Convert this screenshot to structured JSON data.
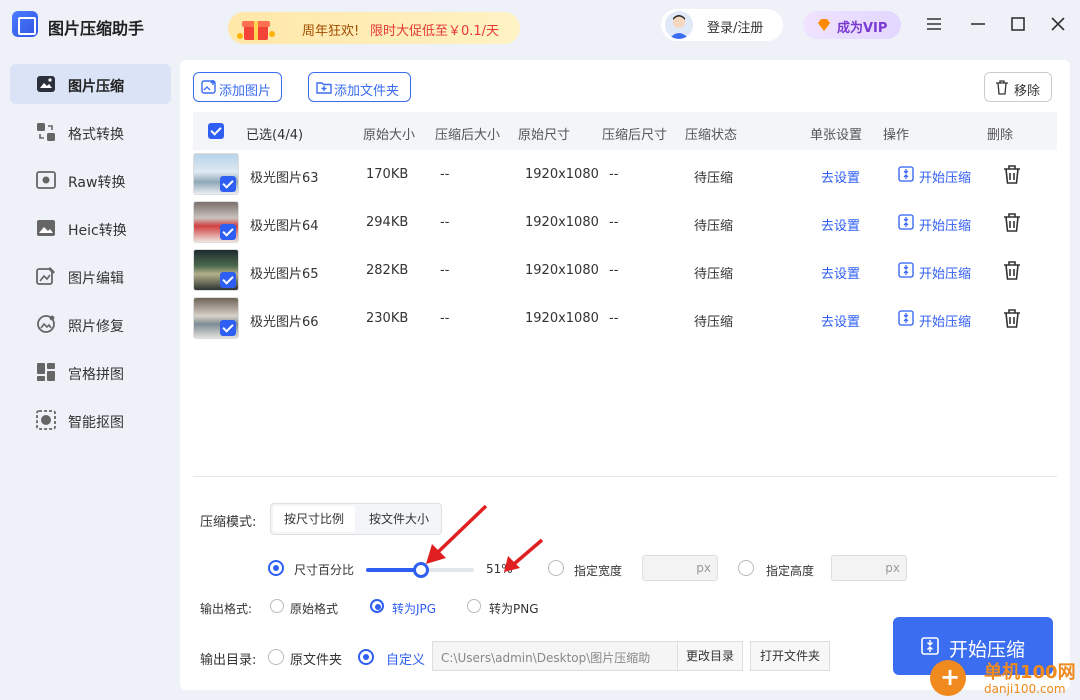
{
  "app": {
    "title": "图片压缩助手"
  },
  "promo": {
    "text1": "周年狂欢!",
    "text2": "限时大促低至￥0.1/天"
  },
  "user": {
    "login_label": "登录/注册"
  },
  "vip": {
    "label": "成为VIP"
  },
  "sidebar": {
    "items": [
      {
        "label": "图片压缩",
        "icon": "image-compress-icon",
        "active": true
      },
      {
        "label": "格式转换",
        "icon": "format-convert-icon"
      },
      {
        "label": "Raw转换",
        "icon": "raw-convert-icon"
      },
      {
        "label": "Heic转换",
        "icon": "heic-convert-icon"
      },
      {
        "label": "图片编辑",
        "icon": "image-edit-icon"
      },
      {
        "label": "照片修复",
        "icon": "photo-repair-icon"
      },
      {
        "label": "宫格拼图",
        "icon": "grid-collage-icon"
      },
      {
        "label": "智能抠图",
        "icon": "smart-cutout-icon"
      }
    ]
  },
  "toolbar": {
    "add_image": "添加图片",
    "add_folder": "添加文件夹",
    "remove": "移除"
  },
  "table": {
    "headers": {
      "selected": "已选(4/4)",
      "original_size": "原始大小",
      "compressed_size": "压缩后大小",
      "original_dim": "原始尺寸",
      "compressed_dim": "压缩后尺寸",
      "status": "压缩状态",
      "single_setting": "单张设置",
      "action": "操作",
      "delete": "删除"
    },
    "rows": [
      {
        "name": "极光图片63",
        "original_size": "170KB",
        "compressed_size": "--",
        "original_dim": "1920x1080",
        "compressed_dim": "--",
        "status": "待压缩",
        "setting": "去设置",
        "action": "开始压缩"
      },
      {
        "name": "极光图片64",
        "original_size": "294KB",
        "compressed_size": "--",
        "original_dim": "1920x1080",
        "compressed_dim": "--",
        "status": "待压缩",
        "setting": "去设置",
        "action": "开始压缩"
      },
      {
        "name": "极光图片65",
        "original_size": "282KB",
        "compressed_size": "--",
        "original_dim": "1920x1080",
        "compressed_dim": "--",
        "status": "待压缩",
        "setting": "去设置",
        "action": "开始压缩"
      },
      {
        "name": "极光图片66",
        "original_size": "230KB",
        "compressed_size": "--",
        "original_dim": "1920x1080",
        "compressed_dim": "--",
        "status": "待压缩",
        "setting": "去设置",
        "action": "开始压缩"
      }
    ]
  },
  "settings": {
    "mode_label": "压缩模式:",
    "mode_tabs": [
      "按尺寸比例",
      "按文件大小"
    ],
    "percent_label": "尺寸百分比",
    "percent_value": "51%",
    "percent_level": 0.51,
    "width_label": "指定宽度",
    "height_label": "指定高度",
    "px_unit": "px",
    "format_label": "输出格式:",
    "format_options": [
      "原始格式",
      "转为JPG",
      "转为PNG"
    ],
    "dir_label": "输出目录:",
    "dir_options": [
      "原文件夹",
      "自定义"
    ],
    "dir_path": "C:\\Users\\admin\\Desktop\\图片压缩助",
    "change_dir": "更改目录",
    "open_folder": "打开文件夹"
  },
  "start_button": "开始压缩",
  "watermark": {
    "line1": "单机100网",
    "line2": "danji100.com"
  },
  "colors": {
    "accent": "#3a6df0",
    "arrow": "#e02020"
  }
}
